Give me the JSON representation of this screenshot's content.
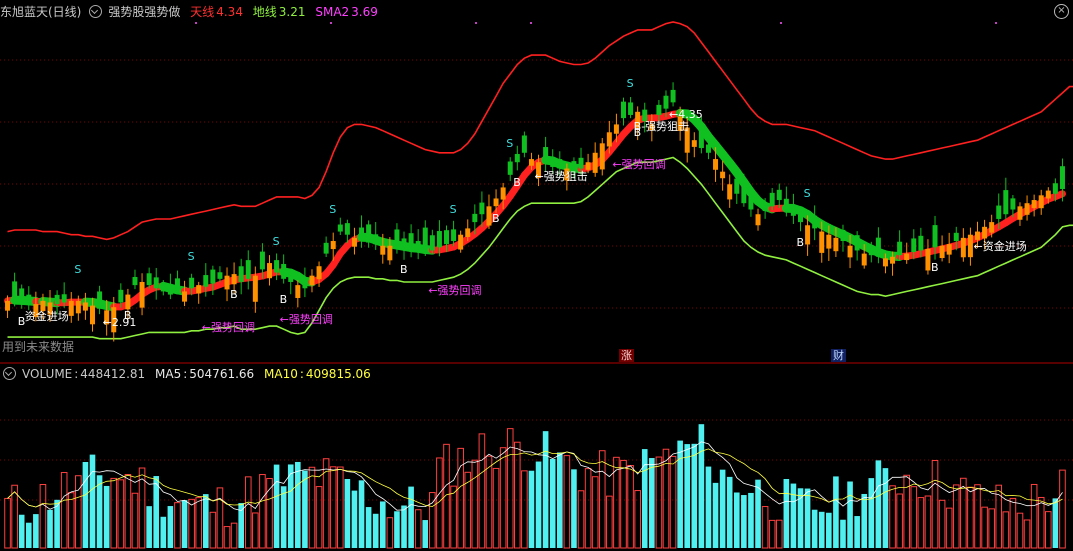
{
  "header": {
    "stock_name": "东旭蓝天(日线)",
    "indicator_name": "强势股强势做",
    "tianxian_label": "天线",
    "tianxian_value": "4.34",
    "dixian_label": "地线",
    "dixian_value": "3.21",
    "sma2_label": "SMA2",
    "sma2_value": "3.69",
    "close_symbol": "×"
  },
  "volume_header": {
    "volume_label": "VOLUME",
    "volume_value": "448412.81",
    "ma5_label": "MA5",
    "ma5_value": "504761.66",
    "ma10_label": "MA10",
    "ma10_value": "409815.06"
  },
  "warning_text": "用到未来数据",
  "colors": {
    "bg": "#000000",
    "tianxian": "#ff2020",
    "dixian": "#90f040",
    "sma2": "#ff40ff",
    "up_band": "#ff2020",
    "down_band": "#10c020",
    "candle_up": "#ff9000",
    "candle_down": "#10c020",
    "vol_up": "#ff4040",
    "vol_down": "#50f0f0",
    "ma5": "#ffffff",
    "ma10": "#ffff40",
    "grid": "#800000"
  },
  "markers": {
    "zhang": "涨",
    "cai": "财"
  },
  "annotations": [
    {
      "text": "B",
      "i": 2
    },
    {
      "text": "资金进场",
      "i": 3
    },
    {
      "text": "S",
      "i": 10
    },
    {
      "text": "←2.91",
      "i": 14
    },
    {
      "text": "B",
      "i": 17
    },
    {
      "text": "S",
      "i": 26
    },
    {
      "text": "←强势回调",
      "i": 28
    },
    {
      "text": "B",
      "i": 32
    },
    {
      "text": "S",
      "i": 38
    },
    {
      "text": "B",
      "i": 39
    },
    {
      "text": "←强势回调",
      "i": 39
    },
    {
      "text": "S",
      "i": 46
    },
    {
      "text": "B",
      "i": 56
    },
    {
      "text": "←强势回调",
      "i": 60
    },
    {
      "text": "S",
      "i": 63
    },
    {
      "text": "B",
      "i": 69
    },
    {
      "text": "S",
      "i": 71
    },
    {
      "text": "B",
      "i": 72
    },
    {
      "text": "←强势狙击",
      "i": 75
    },
    {
      "text": "S",
      "i": 88
    },
    {
      "text": "B",
      "i": 89
    },
    {
      "text": "←强势回调",
      "i": 86
    },
    {
      "text": "B-强势狙击",
      "i": 89
    },
    {
      "text": "←4.35",
      "i": 94
    },
    {
      "text": "S",
      "i": 113
    },
    {
      "text": "B",
      "i": 112
    },
    {
      "text": "B",
      "i": 131
    },
    {
      "text": "←资金进场",
      "i": 137
    }
  ],
  "chart_data": [
    {
      "type": "candlestick",
      "name": "强势股强势做",
      "series": [
        {
          "name": "天线",
          "last": 4.34
        },
        {
          "name": "地线",
          "last": 3.21
        },
        {
          "name": "SMA2",
          "last": 3.69
        }
      ],
      "low_label": 2.91,
      "high_label": 4.35,
      "ylim": [
        2.7,
        4.75
      ],
      "closes": [
        2.98,
        2.99,
        2.98,
        2.97,
        2.96,
        2.98,
        2.97,
        2.96,
        2.97,
        2.98,
        2.98,
        2.97,
        2.95,
        2.93,
        2.92,
        2.94,
        2.97,
        3.02,
        3.08,
        3.1,
        3.08,
        3.06,
        3.04,
        3.02,
        3.05,
        3.04,
        3.06,
        3.08,
        3.07,
        3.09,
        3.12,
        3.14,
        3.15,
        3.1,
        3.12,
        3.14,
        3.18,
        3.22,
        3.16,
        3.12,
        3.1,
        3.08,
        3.06,
        3.14,
        3.2,
        3.28,
        3.36,
        3.42,
        3.4,
        3.38,
        3.36,
        3.35,
        3.34,
        3.33,
        3.33,
        3.32,
        3.31,
        3.3,
        3.31,
        3.29,
        3.3,
        3.32,
        3.34,
        3.36,
        3.4,
        3.44,
        3.48,
        3.53,
        3.58,
        3.63,
        3.7,
        3.78,
        3.86,
        3.92,
        3.88,
        3.86,
        3.85,
        3.83,
        3.82,
        3.82,
        3.8,
        3.82,
        3.86,
        3.92,
        3.98,
        4.05,
        4.1,
        4.14,
        4.16,
        4.18,
        4.12,
        4.1,
        4.16,
        4.2,
        4.24,
        4.15,
        4.08,
        4.0,
        3.95,
        3.92,
        3.88,
        3.8,
        3.72,
        3.66,
        3.6,
        3.56,
        3.53,
        3.55,
        3.58,
        3.62,
        3.56,
        3.52,
        3.48,
        3.46,
        3.44,
        3.42,
        3.4,
        3.38,
        3.36,
        3.33,
        3.3,
        3.28,
        3.27,
        3.26,
        3.25,
        3.26,
        3.27,
        3.28,
        3.29,
        3.3,
        3.31,
        3.32,
        3.33,
        3.34,
        3.36,
        3.38,
        3.4,
        3.42,
        3.45,
        3.48,
        3.5,
        3.53,
        3.56,
        3.58,
        3.6,
        3.62,
        3.65,
        3.68,
        3.66,
        3.69
      ],
      "tianxian": [
        3.42,
        3.43,
        3.43,
        3.43,
        3.43,
        3.42,
        3.42,
        3.42,
        3.41,
        3.4,
        3.4,
        3.39,
        3.39,
        3.38,
        3.37,
        3.38,
        3.4,
        3.42,
        3.45,
        3.48,
        3.49,
        3.5,
        3.5,
        3.5,
        3.51,
        3.52,
        3.53,
        3.54,
        3.55,
        3.56,
        3.57,
        3.58,
        3.59,
        3.58,
        3.58,
        3.58,
        3.6,
        3.62,
        3.64,
        3.64,
        3.64,
        3.64,
        3.63,
        3.65,
        3.7,
        3.8,
        3.92,
        4.02,
        4.08,
        4.1,
        4.1,
        4.09,
        4.08,
        4.06,
        4.04,
        4.02,
        4.0,
        3.98,
        3.96,
        3.94,
        3.93,
        3.92,
        3.92,
        3.92,
        3.94,
        3.98,
        4.04,
        4.12,
        4.2,
        4.28,
        4.36,
        4.42,
        4.48,
        4.52,
        4.54,
        4.54,
        4.54,
        4.52,
        4.5,
        4.49,
        4.48,
        4.48,
        4.49,
        4.52,
        4.56,
        4.6,
        4.63,
        4.66,
        4.68,
        4.7,
        4.7,
        4.7,
        4.72,
        4.74,
        4.75,
        4.74,
        4.72,
        4.68,
        4.62,
        4.56,
        4.5,
        4.44,
        4.38,
        4.32,
        4.26,
        4.2,
        4.15,
        4.12,
        4.1,
        4.1,
        4.1,
        4.09,
        4.08,
        4.07,
        4.06,
        4.04,
        4.02,
        4.0,
        3.98,
        3.96,
        3.94,
        3.92,
        3.9,
        3.89,
        3.88,
        3.88,
        3.89,
        3.9,
        3.91,
        3.92,
        3.93,
        3.94,
        3.95,
        3.96,
        3.97,
        3.98,
        3.99,
        4.0,
        4.02,
        4.04,
        4.06,
        4.08,
        4.1,
        4.12,
        4.14,
        4.16,
        4.18,
        4.22,
        4.26,
        4.3,
        4.34,
        4.34
      ],
      "dixian": [
        2.75,
        2.75,
        2.75,
        2.75,
        2.75,
        2.75,
        2.75,
        2.75,
        2.75,
        2.75,
        2.75,
        2.75,
        2.75,
        2.74,
        2.74,
        2.74,
        2.74,
        2.75,
        2.76,
        2.77,
        2.78,
        2.78,
        2.78,
        2.78,
        2.78,
        2.78,
        2.79,
        2.79,
        2.8,
        2.8,
        2.81,
        2.81,
        2.82,
        2.8,
        2.8,
        2.8,
        2.81,
        2.82,
        2.82,
        2.8,
        2.78,
        2.77,
        2.78,
        2.84,
        2.92,
        3.0,
        3.06,
        3.1,
        3.12,
        3.13,
        3.13,
        3.13,
        3.12,
        3.12,
        3.11,
        3.11,
        3.1,
        3.1,
        3.1,
        3.1,
        3.1,
        3.11,
        3.12,
        3.13,
        3.15,
        3.18,
        3.22,
        3.27,
        3.32,
        3.38,
        3.44,
        3.5,
        3.55,
        3.58,
        3.6,
        3.6,
        3.6,
        3.6,
        3.6,
        3.6,
        3.6,
        3.61,
        3.64,
        3.68,
        3.72,
        3.76,
        3.8,
        3.82,
        3.84,
        3.86,
        3.86,
        3.86,
        3.87,
        3.88,
        3.89,
        3.86,
        3.82,
        3.77,
        3.72,
        3.66,
        3.6,
        3.54,
        3.48,
        3.42,
        3.36,
        3.32,
        3.29,
        3.27,
        3.26,
        3.25,
        3.24,
        3.22,
        3.2,
        3.18,
        3.16,
        3.14,
        3.12,
        3.1,
        3.08,
        3.06,
        3.04,
        3.03,
        3.02,
        3.02,
        3.01,
        3.02,
        3.03,
        3.04,
        3.05,
        3.06,
        3.07,
        3.08,
        3.09,
        3.1,
        3.11,
        3.12,
        3.13,
        3.14,
        3.16,
        3.18,
        3.2,
        3.22,
        3.24,
        3.26,
        3.28,
        3.3,
        3.32,
        3.36,
        3.4,
        3.45,
        3.46,
        3.46
      ],
      "volume_last": 448412.81,
      "ma5_last": 504761.66,
      "ma10_last": 409815.06
    }
  ]
}
